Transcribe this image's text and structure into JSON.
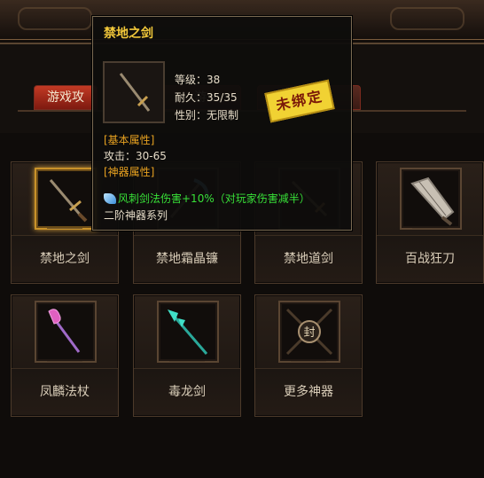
{
  "tabs": [
    {
      "label": "游戏攻",
      "active": true
    },
    {
      "label": "游",
      "active": false
    },
    {
      "label": "",
      "active": false
    }
  ],
  "items": [
    {
      "name": "禁地之剑",
      "icon": "sword-icon",
      "highlighted": true
    },
    {
      "name": "禁地霜晶镰",
      "icon": "scythe-icon",
      "highlighted": false
    },
    {
      "name": "禁地道剑",
      "icon": "dao-sword-icon",
      "highlighted": false
    },
    {
      "name": "百战狂刀",
      "icon": "great-blade-icon",
      "highlighted": false
    },
    {
      "name": "凤麟法杖",
      "icon": "phoenix-staff-icon",
      "highlighted": false
    },
    {
      "name": "毒龙剑",
      "icon": "poison-dragon-spear-icon",
      "highlighted": false
    },
    {
      "name": "更多神器",
      "icon": "sealed-more-icon",
      "highlighted": false
    }
  ],
  "tooltip": {
    "title": "禁地之剑",
    "level": "等级：38",
    "durability": "耐久：35/35",
    "gender": "性别：无限制",
    "stamp": "未绑定",
    "basic_header": "[基本属性]",
    "attack": "攻击：30-65",
    "artifact_header": "[神器属性]",
    "artifact_effect": "风刺剑法伤害+10%（对玩家伤害减半）",
    "series": "二阶神器系列"
  },
  "colors": {
    "title_gold": "#f2c83a",
    "section_orange": "#e8a220",
    "effect_green": "#38e038",
    "tab_red": "#c23a24"
  }
}
